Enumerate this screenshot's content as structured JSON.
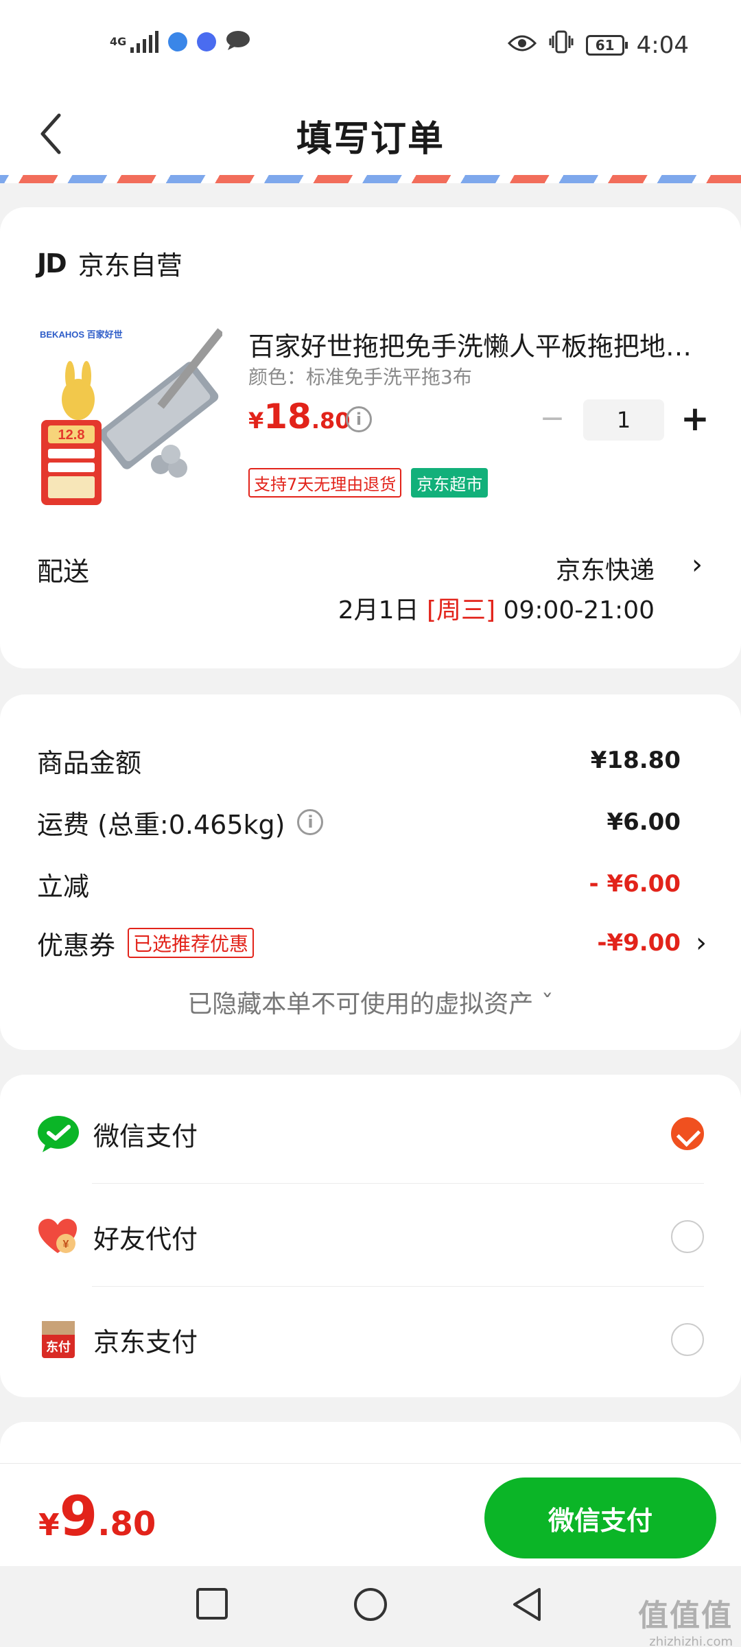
{
  "status_bar": {
    "network": "4G",
    "time": "4:04",
    "battery": "61"
  },
  "header": {
    "title": "填写订单"
  },
  "order": {
    "shop_logo": "JD",
    "shop_name": "京东自营",
    "product": {
      "image_text": "BEKAHOS 百家好世",
      "image_badge_price": "12.8",
      "title": "百家好世拖把免手洗懒人平板拖把地…",
      "spec": "颜色：标准免手洗平拖3布",
      "price_currency": "¥",
      "price_int": "18",
      "price_dec": ".80",
      "info_icon": "i",
      "quantity": "1",
      "tags": [
        "支持7天无理由退货",
        "京东超市"
      ]
    },
    "delivery": {
      "label": "配送",
      "method": "京东快递",
      "date": "2月1日",
      "weekday": "[周三]",
      "time_range": "09:00-21:00"
    }
  },
  "summary": {
    "goods_label": "商品金额",
    "goods_value": "¥18.80",
    "freight_label": "运费 (总重:0.465kg)",
    "freight_value": "¥6.00",
    "discount_label": "立减",
    "discount_value": "- ¥6.00",
    "coupon_label": "优惠券",
    "coupon_tag": "已选推荐优惠",
    "coupon_value": "-¥9.00",
    "hidden_assets": "已隐藏本单不可使用的虚拟资产 ˇ"
  },
  "payment": {
    "methods": [
      {
        "label": "微信支付",
        "icon": "wechat-pay-icon",
        "selected": true
      },
      {
        "label": "好友代付",
        "icon": "friend-pay-icon",
        "selected": false
      },
      {
        "label": "京东支付",
        "icon": "jd-pay-icon",
        "icon_text": "东付",
        "selected": false
      }
    ]
  },
  "bottom": {
    "currency": "¥",
    "total_int": "9",
    "total_dec": ".80",
    "pay_button": "微信支付"
  },
  "watermark": {
    "main": "值值值",
    "sub": "zhizhizhi.com"
  },
  "colors": {
    "accent_red": "#e2231a",
    "wechat_green": "#0bb527",
    "jd_green_tag": "#12b07a",
    "radio_orange": "#f0501f"
  }
}
